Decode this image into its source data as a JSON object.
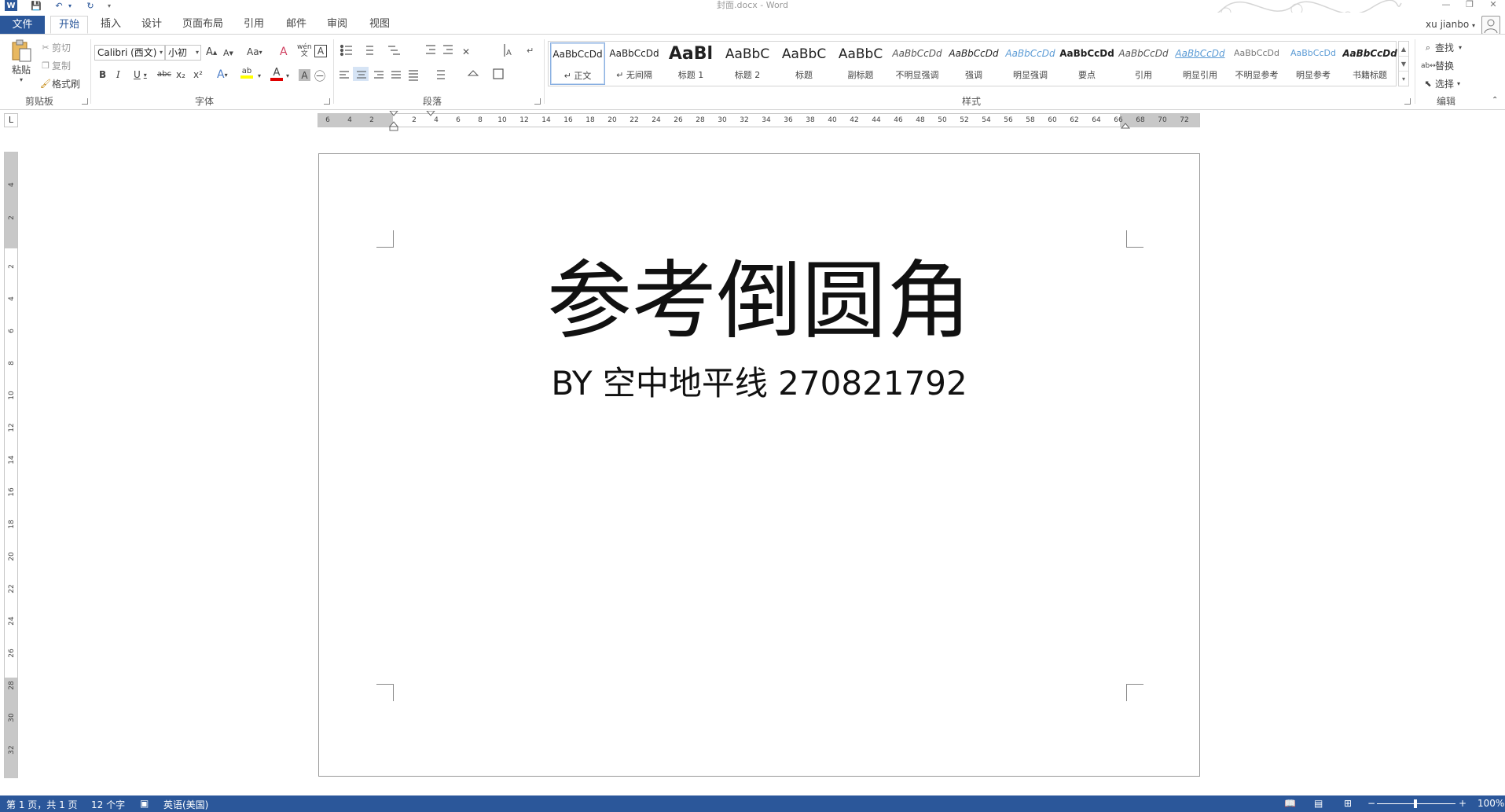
{
  "window": {
    "title": "封面.docx - Word",
    "minimize": "—",
    "restore": "❐",
    "close": "✕"
  },
  "quick_access": {
    "word_icon": "W",
    "save_icon": "💾",
    "undo_icon": "↶",
    "undo_arrow": "▾",
    "redo_icon": "↻",
    "customize": "▾"
  },
  "tabs": [
    "文件",
    "开始",
    "插入",
    "设计",
    "页面布局",
    "引用",
    "邮件",
    "审阅",
    "视图"
  ],
  "active_tab": "开始",
  "user": {
    "name": "xu jianbo",
    "menu_arrow": "▾"
  },
  "ribbon": {
    "clipboard": {
      "label": "剪贴板",
      "paste": "粘贴",
      "paste_arrow": "▾",
      "cut": "剪切",
      "copy": "复制",
      "format_painter": "格式刷"
    },
    "font": {
      "label": "字体",
      "font_name": "Calibri (西文)",
      "font_size": "小初",
      "grow": "A",
      "shrink": "A",
      "change_case": "Aa",
      "bold": "B",
      "italic": "I",
      "underline": "U",
      "strike": "abc",
      "subscript": "x₂",
      "superscript": "x²",
      "text_effects": "A",
      "highlight": "ab",
      "font_color": "A",
      "char_shading": "A",
      "phonetic": "wén",
      "char_border": "A",
      "enclose": "㊀",
      "clear": "A"
    },
    "paragraph": {
      "label": "段落"
    },
    "styles": {
      "label": "样式",
      "items": [
        {
          "preview": "AaBbCcDd",
          "name": "↵ 正文"
        },
        {
          "preview": "AaBbCcDd",
          "name": "↵ 无间隔"
        },
        {
          "preview": "AaBl",
          "name": "标题 1"
        },
        {
          "preview": "AaBbC",
          "name": "标题 2"
        },
        {
          "preview": "AaBbC",
          "name": "标题"
        },
        {
          "preview": "AaBbC",
          "name": "副标题"
        },
        {
          "preview": "AaBbCcDd",
          "name": "不明显强调"
        },
        {
          "preview": "AaBbCcDd",
          "name": "强调"
        },
        {
          "preview": "AaBbCcDd",
          "name": "明显强调"
        },
        {
          "preview": "AaBbCcDd",
          "name": "要点"
        },
        {
          "preview": "AaBbCcDd",
          "name": "引用"
        },
        {
          "preview": "AaBbCcDd",
          "name": "明显引用"
        },
        {
          "preview": "AaBbCcDd",
          "name": "不明显参考"
        },
        {
          "preview": "AaBbCcDd",
          "name": "明显参考"
        },
        {
          "preview": "AaBbCcDd",
          "name": "书籍标题"
        }
      ],
      "selected_index": 0
    },
    "editing": {
      "label": "编辑",
      "find": "查找",
      "find_arrow": "▾",
      "replace": "替换",
      "select": "选择",
      "select_arrow": "▾"
    }
  },
  "ruler": {
    "corner": "L",
    "h_ticks": [
      "6",
      "4",
      "2",
      "2",
      "4",
      "6",
      "8",
      "10",
      "12",
      "14",
      "16",
      "18",
      "20",
      "22",
      "24",
      "26",
      "28",
      "30",
      "32",
      "34",
      "36",
      "38",
      "40",
      "42",
      "44",
      "46",
      "48",
      "50",
      "52",
      "54",
      "56",
      "58",
      "60",
      "62",
      "64",
      "66",
      "68",
      "70",
      "72"
    ],
    "v_ticks": [
      "4",
      "2",
      "2",
      "4",
      "6",
      "8",
      "10",
      "12",
      "14",
      "16",
      "18",
      "20",
      "22",
      "24",
      "26",
      "28",
      "30",
      "32"
    ]
  },
  "document": {
    "heading": "参考倒圆角",
    "subtitle": "BY  空中地平线 270821792"
  },
  "status": {
    "page": "第 1 页，共 1 页",
    "words": "12 个字",
    "language": "英语(美国)",
    "zoom_minus": "−",
    "zoom_plus": "+",
    "zoom": "100%"
  }
}
